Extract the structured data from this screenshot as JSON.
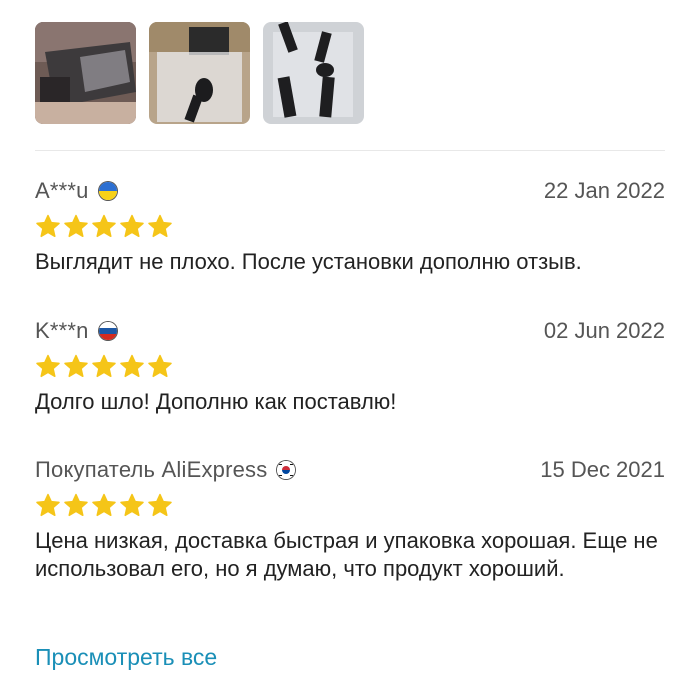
{
  "thumbnails": [
    {
      "icon": "product-photo-box"
    },
    {
      "icon": "product-photo-valve"
    },
    {
      "icon": "product-photo-valves-bag"
    }
  ],
  "reviews": [
    {
      "author": "A***u",
      "flag": "ukraine-flag-icon",
      "date": "22 Jan 2022",
      "rating": 5,
      "text": "Выглядит не плохо. После установки дополню отзыв."
    },
    {
      "author": "K***n",
      "flag": "russia-flag-icon",
      "date": "02 Jun 2022",
      "rating": 5,
      "text": "Долго шло! Дополню как поставлю!"
    },
    {
      "author": "Покупатель AliExpress",
      "flag": "south-korea-flag-icon",
      "date": "15 Dec 2021",
      "rating": 5,
      "text": "Цена низкая, доставка быстрая и упаковка хорошая. Еще не использовал его, но я думаю, что продукт хороший."
    }
  ],
  "view_all_label": "Просмотреть все",
  "colors": {
    "star": "#f5c518",
    "link": "#1a8fb7"
  }
}
